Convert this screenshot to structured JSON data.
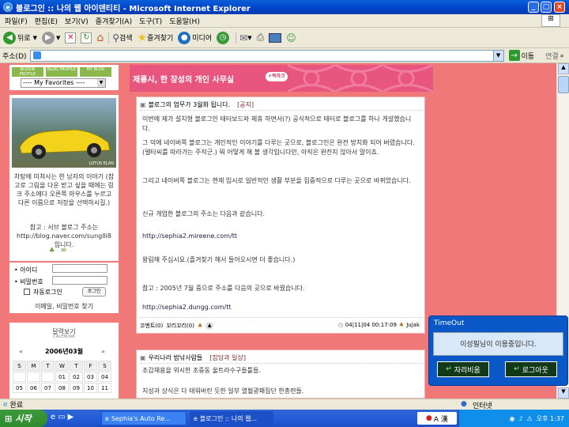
{
  "window": {
    "title": "블로그인 :: 나의 웹 아이덴티티 - Microsoft Internet Explorer"
  },
  "menu": [
    "파일(F)",
    "편집(E)",
    "보기(V)",
    "즐겨찾기(A)",
    "도구(T)",
    "도움말(H)"
  ],
  "toolbar": {
    "back": "뒤로",
    "search": "검색",
    "favorites": "즐겨찾기",
    "media": "미디어"
  },
  "address": {
    "label": "주소(D)",
    "value": "",
    "go": "이동",
    "links": "연결"
  },
  "sidebar": {
    "badges": [
      "BLOGIN PROFILE",
      "BLOG PROFILE",
      "MY BLOG"
    ],
    "favorites_select": "---- My Favorites ----",
    "car_caption": "LOTUS ELAN",
    "profile_text": "차탕에 미쳐사는 한 남자의 이야기 (참고로 그림을 다운 받고 싶을 때에는 링크 주소에다 오른쪽 마우스를 누르고 다른 이름으로 저장을 선택하시길.)",
    "note_text": "참고 : 서브 블로그 주소는 http://blog.naver.com/sunglli8 입니다.",
    "login": {
      "id_label": "아이디",
      "pw_label": "비밀번호",
      "auto_login": "자동로그인",
      "login_btn": "로그인",
      "find_link": "이메일, 비밀번호 찾기"
    },
    "calendar": {
      "title": "달력보기",
      "subtitle": "CALENDAR",
      "month": "2006년03월",
      "days": [
        "S",
        "M",
        "T",
        "W",
        "T",
        "F",
        "S"
      ],
      "weeks": [
        [
          "",
          "",
          "",
          "01",
          "02",
          "03",
          "04"
        ],
        [
          "05",
          "06",
          "07",
          "08",
          "09",
          "10",
          "11"
        ]
      ]
    }
  },
  "header": {
    "title": "제룡시, 한 장성의 개인 사무실",
    "button": "+북마크"
  },
  "post1": {
    "title": "블로그의 업무가 3월화 됩니다.",
    "tag": "[공지]",
    "paragraphs": [
      "이번에 제가 설치형 블로그인 태터보드와 제휴 하면서(?) 공식적으로 태터로 블로그를 하나 개설했습니다.",
      "그 덕에 네이버쪽 블로그는 개인적인 이야기를 다루는 곳으로, 블로그인은 완전 방치화 되어 버렸습니다.(델타씨를 따라가는 주작군.) 뭐 어떻게 해 볼 생각입니다만, 아직은 완전치 않아서 말이죠.",
      "그리고 네이버쪽 블로그는 현재 임시로 일반적인 생활 부분을 집중적으로 다루는 곳으로 바뀌었습니다.",
      "신규 개업한 블로그의 주소는 다음과 같습니다.",
      "http://sephia2.mireene.com/tt",
      "왕림해 주십시요.(즐겨찾기 해서 들어오시면 더 좋습니다.)",
      "참고 : 2005년 7월 중으로 주소를 다음의 곳으로 바꿨습니다.",
      "http://sephia2.dungg.com/tt"
    ],
    "footer_comments": "코멘트(0)",
    "footer_trackback": "꼬리꼬리(0)",
    "date": "04|11|04 00:17:09",
    "author": "Jujak"
  },
  "post2": {
    "title": "우리나라 밤낚사람들",
    "tag": "[잡담과 일상]",
    "paragraphs": [
      "조갑채용을 위시한 조중동 울트라수구들틀들.",
      "지성과 상식은 다 태워버린 듯한 일부 열혈광패집단 한총련들."
    ]
  },
  "timeout_popup": {
    "title": "TimeOut",
    "message": "이성필님이 이용중입니다.",
    "btn_away": "자리비움",
    "btn_logout": "로그아웃"
  },
  "status": {
    "left": "완료",
    "zone": "인터넷"
  },
  "taskbar": {
    "start": "시작",
    "tasks": [
      "Sephia's Auto Re...",
      "블로그인 :: 나의 웹..."
    ],
    "ime": "A 漢",
    "clock": "오후 1:37"
  },
  "colors": {
    "page_bg": "#F07878",
    "header": "#E8557E",
    "title_bar": "#0042C8",
    "timeout": "#0A58C8"
  }
}
